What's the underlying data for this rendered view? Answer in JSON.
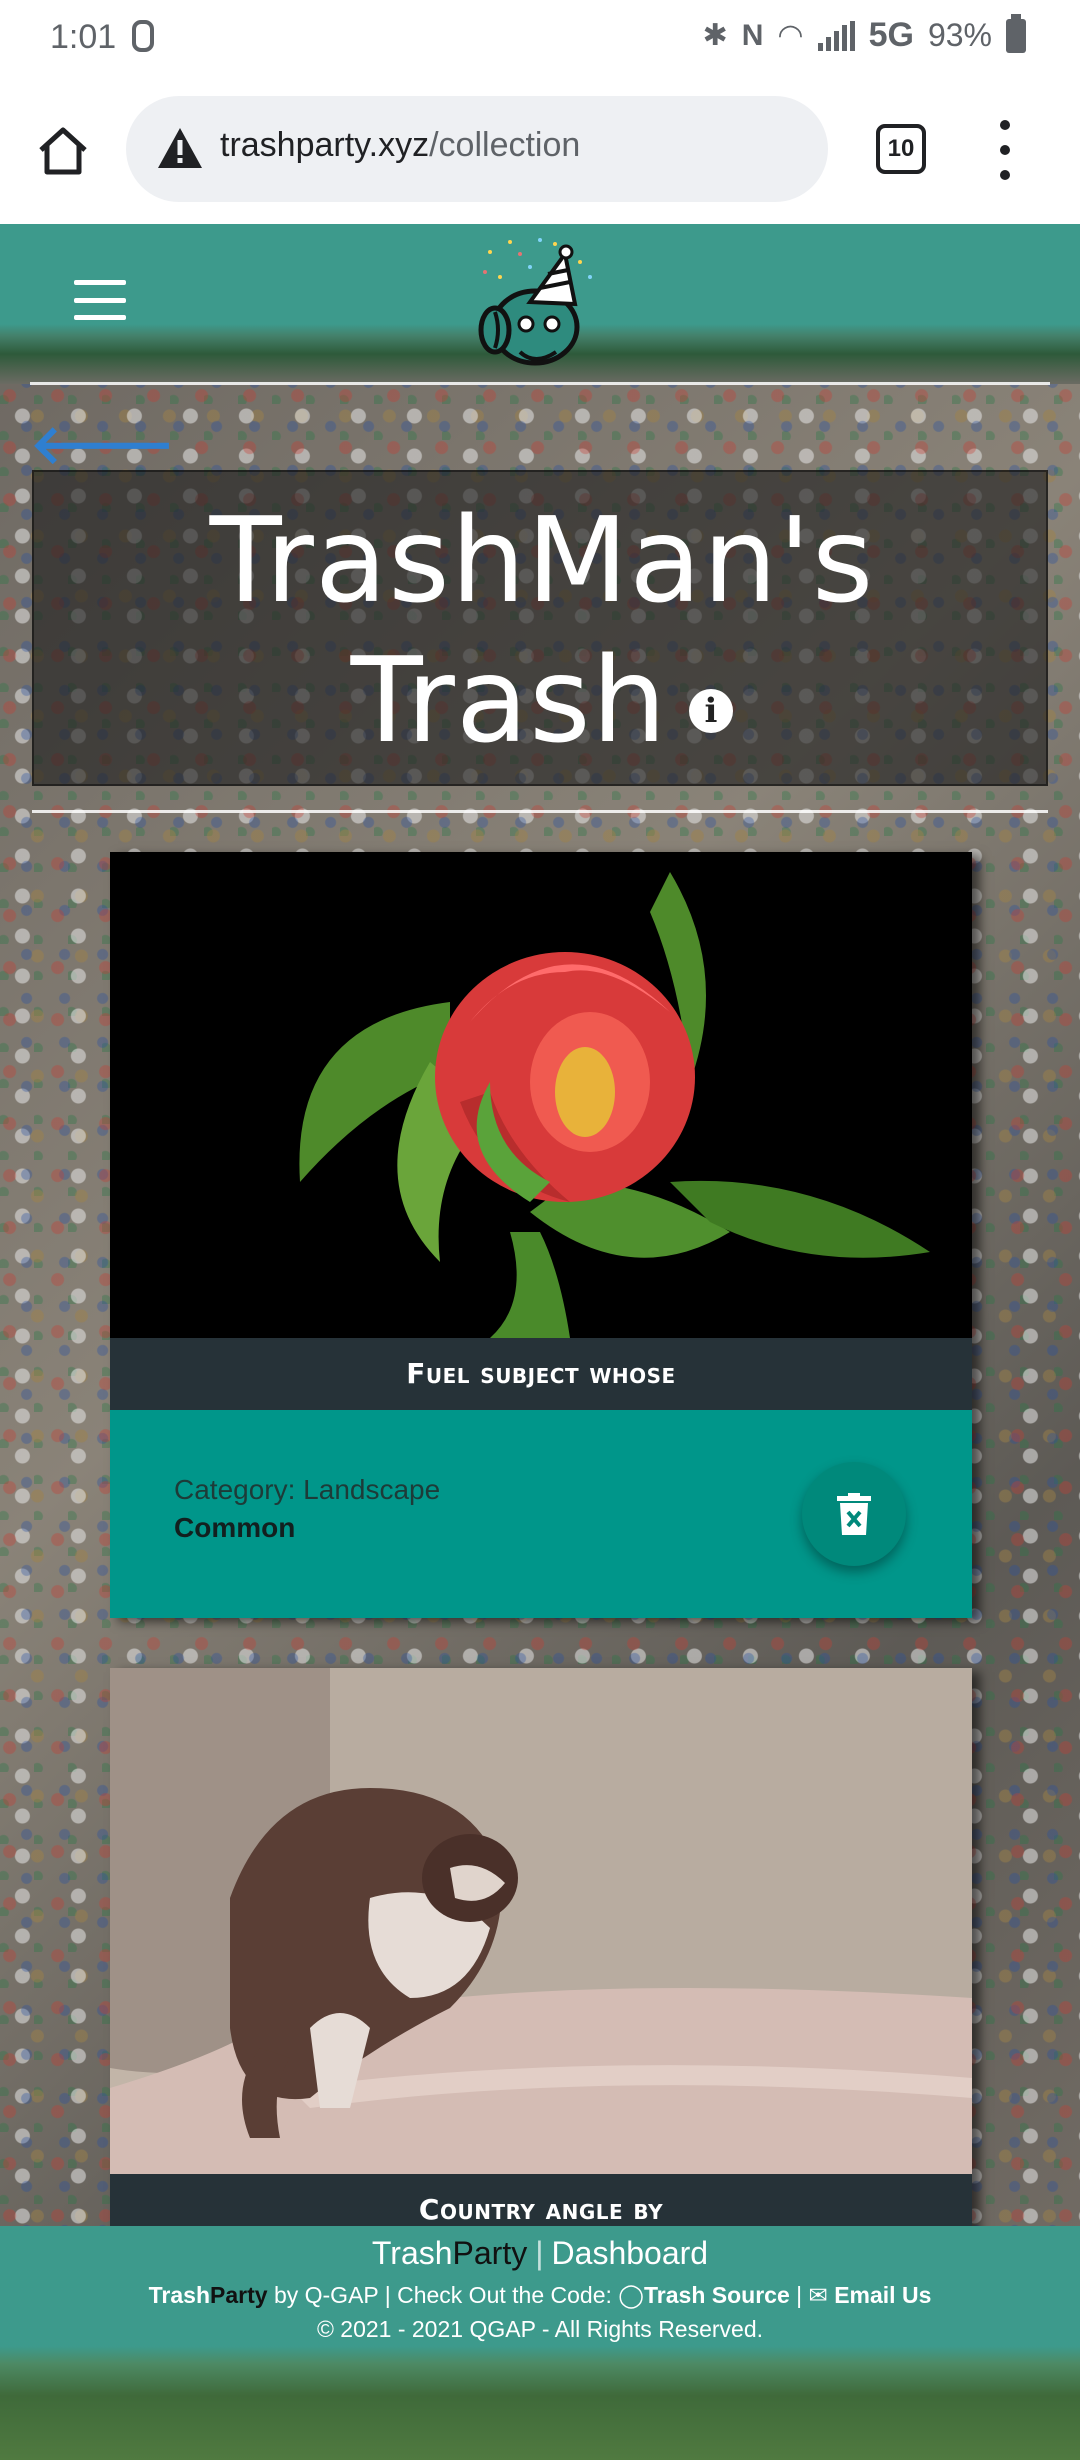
{
  "status_bar": {
    "time": "1:01",
    "network": "5G",
    "battery": "93%"
  },
  "browser": {
    "url_host": "trashparty.xyz",
    "url_path": "/collection",
    "tab_count": "10"
  },
  "page": {
    "title_line1": "TrashMan's",
    "title_line2": "Trash",
    "cards": [
      {
        "caption": "Fuel subject whose",
        "category": "Category: Landscape",
        "rarity": "Common"
      },
      {
        "caption": "Country angle by"
      }
    ]
  },
  "footer": {
    "brand_trash": "Trash",
    "brand_party": "Party",
    "dashboard": "Dashboard",
    "by_trash": "Trash",
    "by_party": "Party",
    "by_text": " by Q-GAP | Check Out the Code: ",
    "source_label": "Trash Source",
    "email_label": "Email Us",
    "copyright": "© 2021 - 2021 QGAP - All Rights Reserved."
  }
}
